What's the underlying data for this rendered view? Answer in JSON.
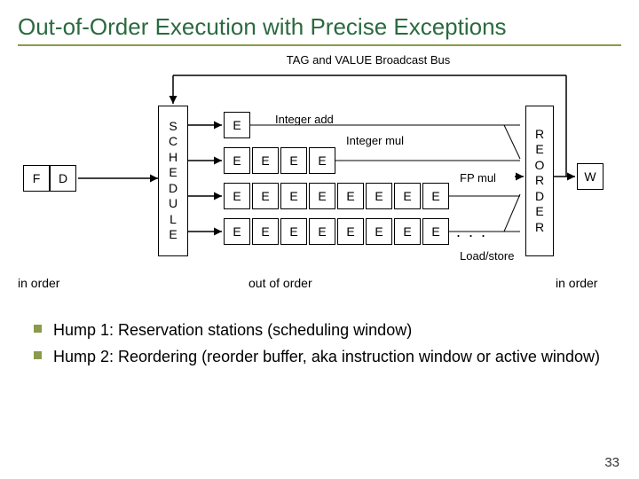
{
  "title": "Out-of-Order Execution with Precise Exceptions",
  "subtitle": "TAG and VALUE Broadcast Bus",
  "stages": {
    "F": "F",
    "D": "D",
    "W": "W"
  },
  "schedule_letters": [
    "S",
    "C",
    "H",
    "E",
    "D",
    "U",
    "L",
    "E"
  ],
  "reorder_letters": [
    "R",
    "E",
    "O",
    "R",
    "D",
    "E",
    "R"
  ],
  "e_label": "E",
  "unit_labels": {
    "int_add": "Integer add",
    "int_mul": "Integer mul",
    "fp_mul": "FP mul",
    "load_store": "Load/store"
  },
  "phase_labels": {
    "in_order_left": "in order",
    "out_of_order": "out of order",
    "in_order_right": "in order"
  },
  "bullets": [
    "Hump 1: Reservation stations (scheduling window)",
    "Hump 2: Reordering (reorder buffer, aka instruction window or active window)"
  ],
  "slide_number": "33",
  "chart_data": {
    "type": "diagram",
    "pipeline": [
      {
        "stage": "F",
        "phase": "in order"
      },
      {
        "stage": "D",
        "phase": "in order"
      },
      {
        "stage": "SCHEDULE",
        "phase": "out of order",
        "note": "Reservation stations / scheduling window"
      },
      {
        "stage": "E",
        "phase": "out of order",
        "units": [
          {
            "name": "Integer add",
            "latency": 1
          },
          {
            "name": "Integer mul",
            "latency": 4
          },
          {
            "name": "FP mul",
            "latency": 8
          },
          {
            "name": "Load/store",
            "latency": 8
          }
        ]
      },
      {
        "stage": "REORDER",
        "phase": "in order",
        "note": "Reorder buffer / instruction window"
      },
      {
        "stage": "W",
        "phase": "in order"
      }
    ],
    "bus": "TAG and VALUE Broadcast Bus feeds back to SCHEDULE"
  }
}
